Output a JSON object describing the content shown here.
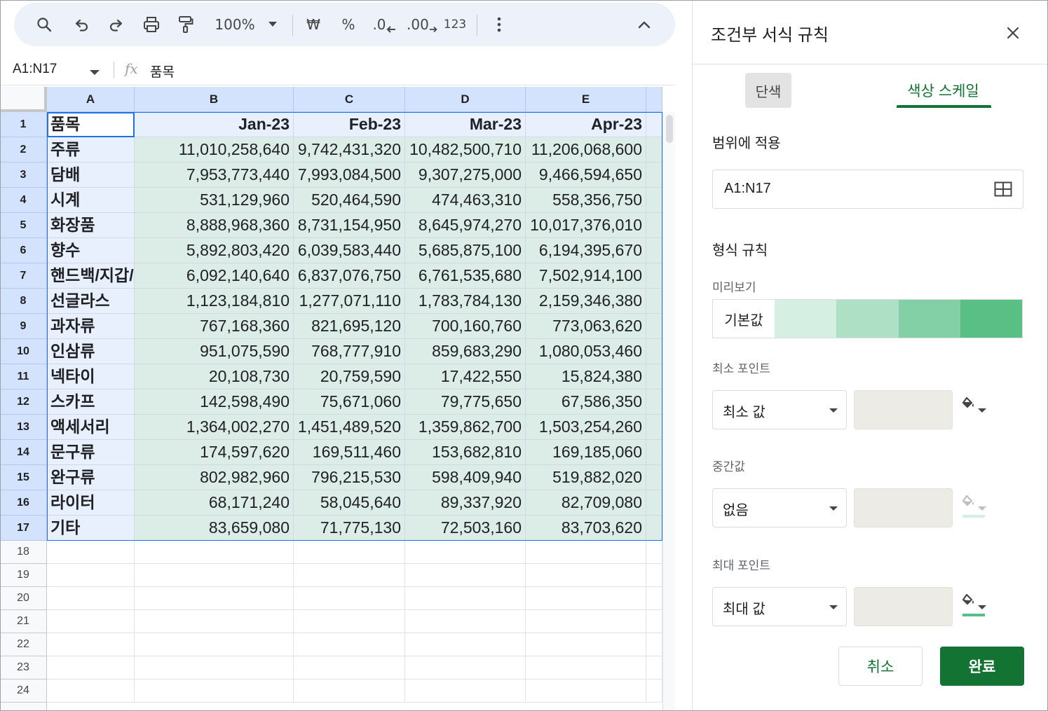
{
  "toolbar": {
    "zoom": "100%",
    "currency": "₩",
    "percent": "%",
    "decrease_decimal": ".0",
    "increase_decimal": ".00",
    "number_format": "123"
  },
  "formula_bar": {
    "name_box": "A1:N17",
    "fx": "fx",
    "value": "품목"
  },
  "sheet": {
    "columns": [
      "A",
      "B",
      "C",
      "D",
      "E"
    ],
    "rows": [
      {
        "num": "1",
        "cells": [
          "품목",
          "Jan-23",
          "Feb-23",
          "Mar-23",
          "Apr-23"
        ]
      },
      {
        "num": "2",
        "cells": [
          "주류",
          "11,010,258,640",
          "9,742,431,320",
          "10,482,500,710",
          "11,206,068,600"
        ]
      },
      {
        "num": "3",
        "cells": [
          "담배",
          "7,953,773,440",
          "7,993,084,500",
          "9,307,275,000",
          "9,466,594,650"
        ]
      },
      {
        "num": "4",
        "cells": [
          "시계",
          "531,129,960",
          "520,464,590",
          "474,463,310",
          "558,356,750"
        ]
      },
      {
        "num": "5",
        "cells": [
          "화장품",
          "8,888,968,360",
          "8,731,154,950",
          "8,645,974,270",
          "10,017,376,010"
        ]
      },
      {
        "num": "6",
        "cells": [
          "향수",
          "5,892,803,420",
          "6,039,583,440",
          "5,685,875,100",
          "6,194,395,670"
        ]
      },
      {
        "num": "7",
        "cells": [
          "핸드백/지갑/",
          "6,092,140,640",
          "6,837,076,750",
          "6,761,535,680",
          "7,502,914,100"
        ]
      },
      {
        "num": "8",
        "cells": [
          "선글라스",
          "1,123,184,810",
          "1,277,071,110",
          "1,783,784,130",
          "2,159,346,380"
        ]
      },
      {
        "num": "9",
        "cells": [
          "과자류",
          "767,168,360",
          "821,695,120",
          "700,160,760",
          "773,063,620"
        ]
      },
      {
        "num": "10",
        "cells": [
          "인삼류",
          "951,075,590",
          "768,777,910",
          "859,683,290",
          "1,080,053,460"
        ]
      },
      {
        "num": "11",
        "cells": [
          "넥타이",
          "20,108,730",
          "20,759,590",
          "17,422,550",
          "15,824,380"
        ]
      },
      {
        "num": "12",
        "cells": [
          "스카프",
          "142,598,490",
          "75,671,060",
          "79,775,650",
          "67,586,350"
        ]
      },
      {
        "num": "13",
        "cells": [
          "액세서리",
          "1,364,002,270",
          "1,451,489,520",
          "1,359,862,700",
          "1,503,254,260"
        ]
      },
      {
        "num": "14",
        "cells": [
          "문구류",
          "174,597,620",
          "169,511,460",
          "153,682,810",
          "169,185,060"
        ]
      },
      {
        "num": "15",
        "cells": [
          "완구류",
          "802,982,960",
          "796,215,530",
          "598,409,940",
          "519,882,020"
        ]
      },
      {
        "num": "16",
        "cells": [
          "라이터",
          "68,171,240",
          "58,045,640",
          "89,337,920",
          "82,709,080"
        ]
      },
      {
        "num": "17",
        "cells": [
          "기타",
          "83,659,080",
          "71,775,130",
          "72,503,160",
          "83,703,620"
        ]
      }
    ],
    "empty_rows": [
      "18",
      "19",
      "20",
      "21",
      "22",
      "23",
      "24"
    ],
    "shade_color": "#dcede8",
    "selection_color": "#e8f0fe"
  },
  "panel": {
    "title": "조건부 서식 규칙",
    "tab_single": "단색",
    "tab_scale": "색상 스케일",
    "apply_range_label": "범위에 적용",
    "range_value": "A1:N17",
    "format_rules_label": "형식 규칙",
    "preview_label": "미리보기",
    "preview_default": "기본값",
    "preview_colors": [
      "#d5f0e2",
      "#ade0c4",
      "#84d0a6",
      "#59bf84"
    ],
    "min_label": "최소 포인트",
    "min_select": "최소 값",
    "mid_label": "중간값",
    "mid_select": "없음",
    "max_label": "최대 포인트",
    "max_select": "최대 값",
    "min_color": "#ffffff",
    "mid_color": "#d6efe3",
    "max_color": "#57bb8a",
    "cancel": "취소",
    "done": "완료"
  }
}
